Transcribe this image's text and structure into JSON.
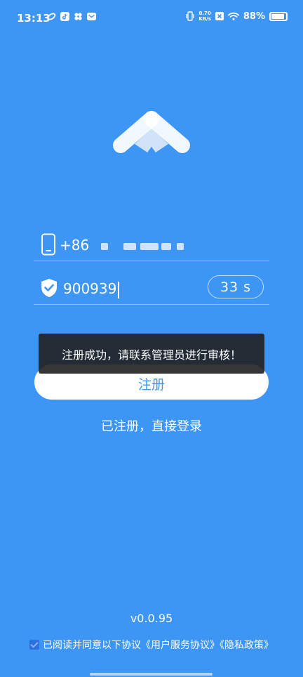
{
  "status_bar": {
    "time": "13:13",
    "net_speed_value": "0.70",
    "net_speed_unit": "KB/s",
    "battery": "88%",
    "battery_level": 0.88
  },
  "phone": {
    "prefix": "+86",
    "icon": "smartphone-icon"
  },
  "verification": {
    "code": "900939",
    "countdown": "33 s",
    "icon": "shield-check-icon"
  },
  "toast": {
    "message": "注册成功，请联系管理员进行审核！"
  },
  "register_button": {
    "label": "注册"
  },
  "login_link": {
    "label": "已注册，直接登录"
  },
  "version": "v0.0.95",
  "agreement": {
    "text": "已阅读并同意以下协议《用户服务协议》《隐私政策》",
    "checked": true
  },
  "colors": {
    "background": "#3d95f4",
    "button_text": "#3d95f4",
    "toast_bg": "#202020"
  }
}
